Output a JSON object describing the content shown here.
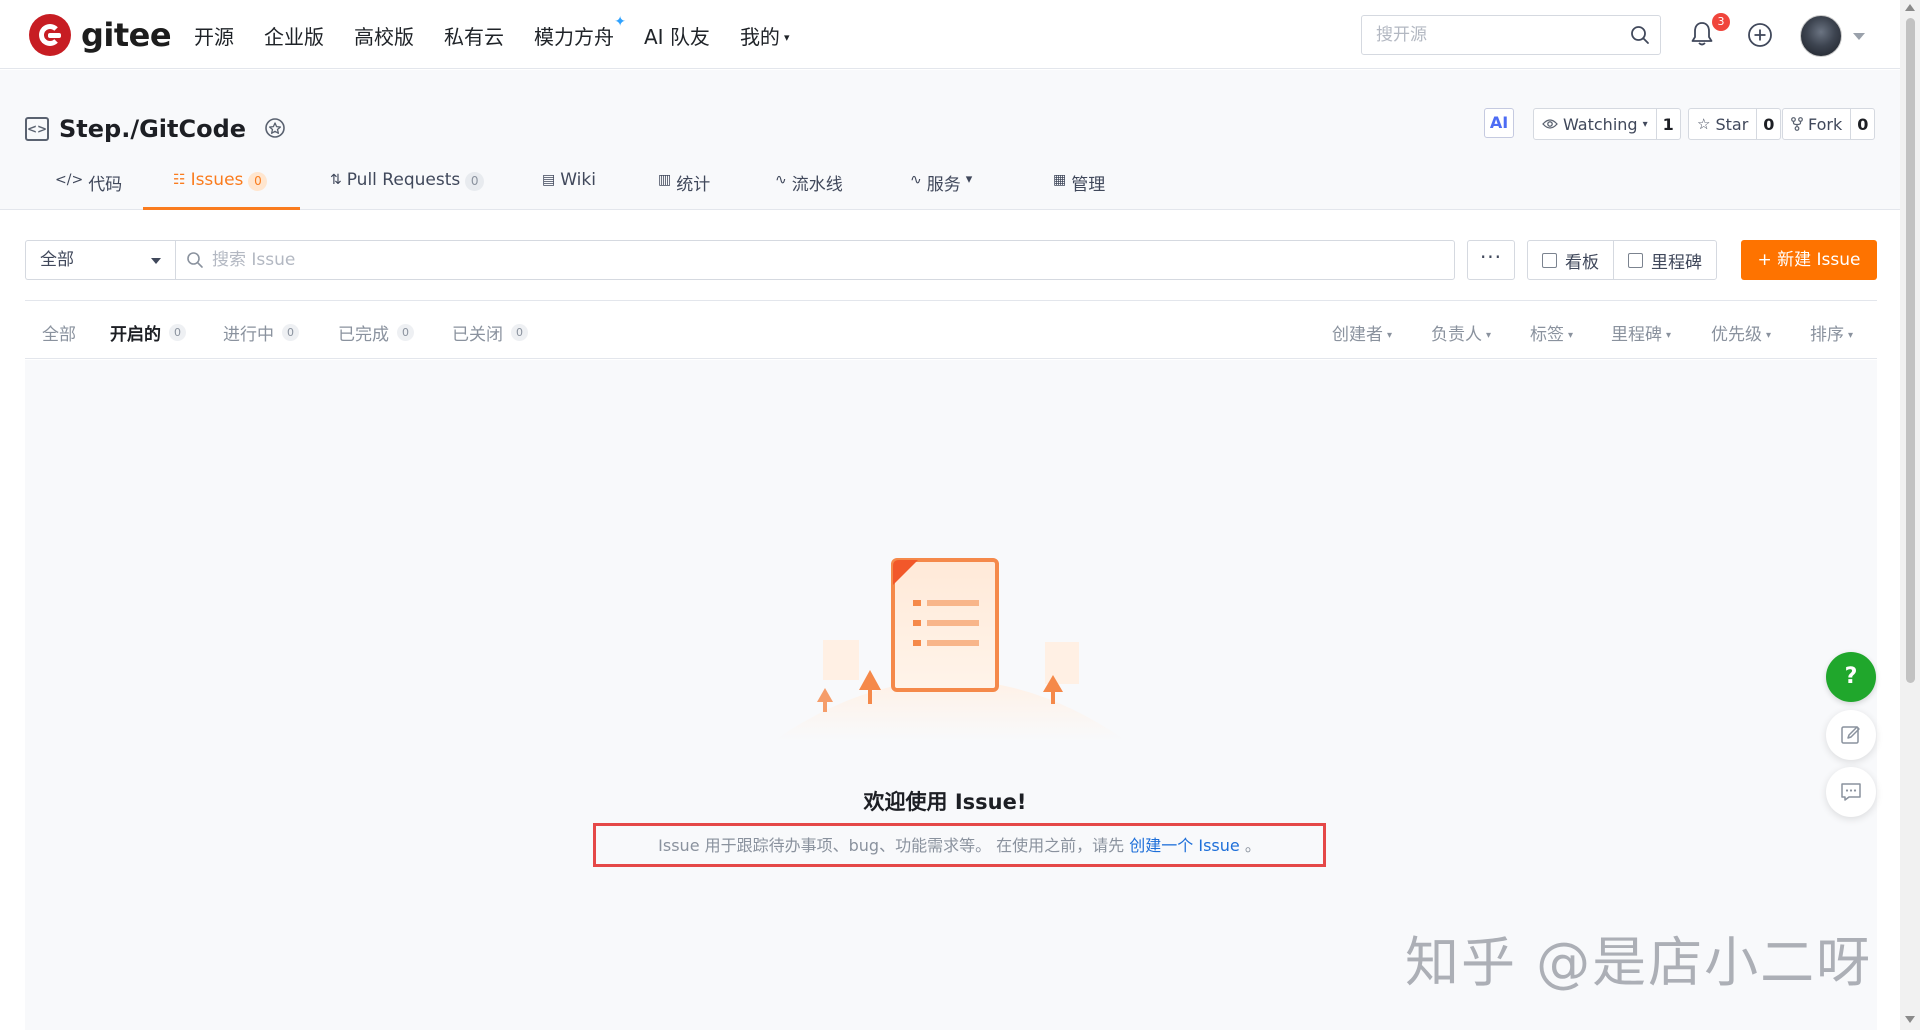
{
  "topnav": {
    "logo_text": "gitee",
    "items": [
      {
        "label": "开源"
      },
      {
        "label": "企业版"
      },
      {
        "label": "高校版"
      },
      {
        "label": "私有云"
      },
      {
        "label": "模力方舟",
        "spark": "✦"
      },
      {
        "label": "AI 队友"
      },
      {
        "label": "我的",
        "caret": "▾"
      }
    ],
    "search_placeholder": "搜开源",
    "notification_count": "3",
    "icons": [
      "search-icon",
      "bell-icon",
      "plus-circle-icon",
      "avatar",
      "chevron-down-icon"
    ]
  },
  "repo": {
    "name": "Step./GitCode",
    "ai_label": "AI",
    "watching": {
      "label": "Watching",
      "count": "1"
    },
    "star": {
      "label": "Star",
      "count": "0"
    },
    "fork": {
      "label": "Fork",
      "count": "0"
    }
  },
  "tabs": [
    {
      "label": "代码",
      "icon": "</>"
    },
    {
      "label": "Issues",
      "count": "0",
      "icon": "☷"
    },
    {
      "label": "Pull Requests",
      "count": "0",
      "icon": "⇅"
    },
    {
      "label": "Wiki",
      "icon": "▤"
    },
    {
      "label": "统计",
      "icon": "▥"
    },
    {
      "label": "流水线",
      "icon": "∿"
    },
    {
      "label": "服务",
      "icon": "∿",
      "caret": "▾"
    },
    {
      "label": "管理",
      "icon": "▦"
    }
  ],
  "toolbar": {
    "filter_value": "全部",
    "search_placeholder": "搜索 Issue",
    "more_label": "···",
    "board_label": "看板",
    "milestone_label": "里程碑",
    "new_issue_label": "+ 新建 Issue"
  },
  "status_tabs": [
    {
      "label": "全部"
    },
    {
      "label": "开启的",
      "count": "0"
    },
    {
      "label": "进行中",
      "count": "0"
    },
    {
      "label": "已完成",
      "count": "0"
    },
    {
      "label": "已关闭",
      "count": "0"
    }
  ],
  "filters": [
    "创建者",
    "负责人",
    "标签",
    "里程碑",
    "优先级",
    "排序"
  ],
  "empty": {
    "title": "欢迎使用 Issue!",
    "desc_prefix": "Issue 用于跟踪待办事项、bug、功能需求等。 在使用之前，请先",
    "desc_link": "创建一个 Issue",
    "desc_suffix": "。"
  },
  "fab": {
    "help_label": "?"
  },
  "watermark": "知乎 @是店小二呀",
  "colors": {
    "accent": "#fe7300",
    "brand": "#c71d23",
    "help_green": "#20a72c",
    "link": "#1e6fd9",
    "highlight": "#e54848"
  }
}
